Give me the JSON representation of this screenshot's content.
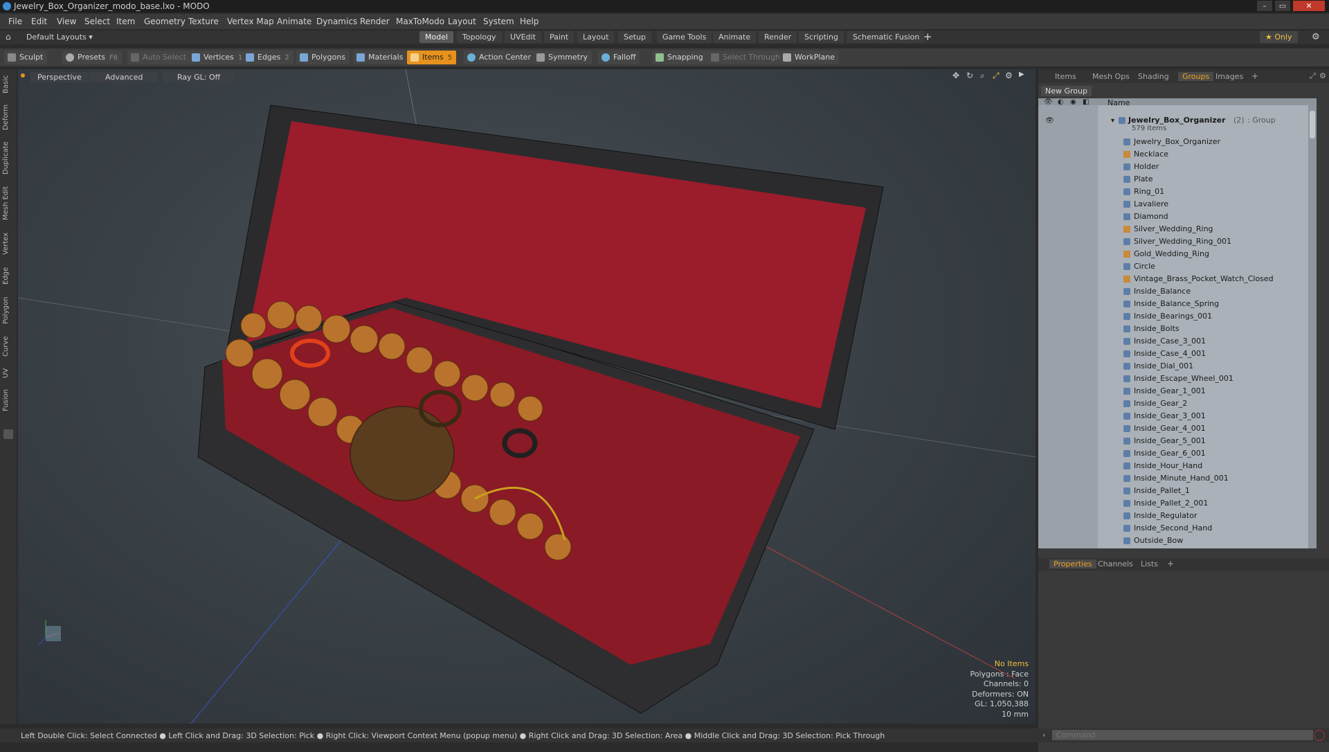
{
  "window": {
    "title": "Jewelry_Box_Organizer_modo_base.lxo - MODO",
    "controls": [
      "–",
      "▭",
      "✕"
    ]
  },
  "menubar": [
    "File",
    "Edit",
    "View",
    "Select",
    "Item",
    "Geometry",
    "Texture",
    "Vertex Map",
    "Animate",
    "Dynamics",
    "Render",
    "MaxToModo",
    "Layout",
    "System",
    "Help"
  ],
  "layouts": {
    "default_layouts": "Default Layouts ▾",
    "tabs": [
      "Model",
      "Topology",
      "UVEdit",
      "Paint",
      "Layout",
      "Setup",
      "Game Tools",
      "Animate",
      "Render",
      "Scripting",
      "Schematic Fusion"
    ],
    "active_tab": "Model",
    "only": "★ Only"
  },
  "toolbar": {
    "sculpt": "Sculpt",
    "presets": "Presets",
    "presets_hint": "F6",
    "auto_select": "Auto Select",
    "vertices": "Vertices",
    "vertices_hint": "1",
    "edges": "Edges",
    "edges_hint": "2",
    "polygons": "Polygons",
    "materials": "Materials",
    "items": "Items",
    "items_hint": "5",
    "action_center": "Action Center",
    "symmetry": "Symmetry",
    "falloff": "Falloff",
    "snapping": "Snapping",
    "select_through": "Select Through",
    "workplane": "WorkPlane"
  },
  "left_tabs": [
    "Basic",
    "Deform",
    "Duplicate",
    "Mesh Edit",
    "Vertex",
    "Edge",
    "Polygon",
    "Curve",
    "UV",
    "Fusion"
  ],
  "viewport": {
    "view": "Perspective",
    "advanced": "Advanced",
    "raygl": "Ray GL: Off",
    "stats": {
      "no_items": "No Items",
      "polygons": "Polygons : Face",
      "channels": "Channels: 0",
      "deformers": "Deformers: ON",
      "gl": "GL: 1,050,388",
      "scale": "10 mm"
    }
  },
  "right_panel": {
    "tabs": [
      "Items",
      "Mesh Ops",
      "Shading",
      "Groups",
      "Images"
    ],
    "active_tab": "Groups",
    "new_group": "New Group",
    "column_name": "Name",
    "group": {
      "name": "Jewelry_Box_Organizer",
      "count": "(2)",
      "type": ": Group",
      "items_count": "579 Items"
    },
    "items": [
      "Jewelry_Box_Organizer",
      "Necklace",
      "Holder",
      "Plate",
      "Ring_01",
      "Lavaliere",
      "Diamond",
      "Silver_Wedding_Ring",
      "Silver_Wedding_Ring_001",
      "Gold_Wedding_Ring",
      "Circle",
      "Vintage_Brass_Pocket_Watch_Closed",
      "Inside_Balance",
      "Inside_Balance_Spring",
      "Inside_Bearings_001",
      "Inside_Bolts",
      "Inside_Case_3_001",
      "Inside_Case_4_001",
      "Inside_Dial_001",
      "Inside_Escape_Wheel_001",
      "Inside_Gear_1_001",
      "Inside_Gear_2",
      "Inside_Gear_3_001",
      "Inside_Gear_4_001",
      "Inside_Gear_5_001",
      "Inside_Gear_6_001",
      "Inside_Hour_Hand",
      "Inside_Minute_Hand_001",
      "Inside_Pallet_1",
      "Inside_Pallet_2_001",
      "Inside_Regulator",
      "Inside_Second_Hand",
      "Outside_Bow"
    ],
    "props_tabs": [
      "Properties",
      "Channels",
      "Lists"
    ],
    "props_active": "Properties"
  },
  "statusbar": {
    "text": "Left Double Click: Select Connected ● Left Click and Drag: 3D Selection: Pick ● Right Click: Viewport Context Menu (popup menu) ● Right Click and Drag: 3D Selection: Area ● Middle Click and Drag: 3D Selection: Pick Through"
  },
  "command": {
    "placeholder": "Command"
  }
}
